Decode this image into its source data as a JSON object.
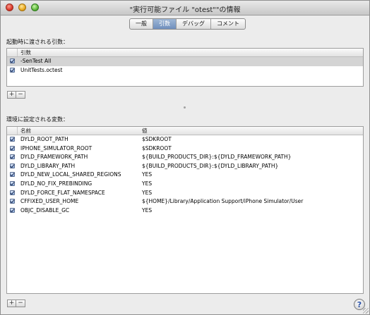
{
  "window": {
    "title": "\"実行可能ファイル \"otest\"\"の情報"
  },
  "tabs": [
    {
      "label": "一般"
    },
    {
      "label": "引数"
    },
    {
      "label": "デバッグ"
    },
    {
      "label": "コメント"
    }
  ],
  "arguments": {
    "section_label": "起動時に渡される引数：",
    "column_header": "引数",
    "rows": [
      {
        "value": "-SenTest All",
        "checked": true
      },
      {
        "value": "UnitTests.octest",
        "checked": true
      }
    ],
    "add_label": "+",
    "remove_label": "−"
  },
  "environment": {
    "section_label": "環境に設定される変数：",
    "column_name": "名前",
    "column_value": "値",
    "rows": [
      {
        "name": "DYLD_ROOT_PATH",
        "value": "$SDKROOT",
        "checked": true
      },
      {
        "name": "IPHONE_SIMULATOR_ROOT",
        "value": "$SDKROOT",
        "checked": true
      },
      {
        "name": "DYLD_FRAMEWORK_PATH",
        "value": "${BUILD_PRODUCTS_DIR}:${DYLD_FRAMEWORK_PATH}",
        "checked": true
      },
      {
        "name": "DYLD_LIBRARY_PATH",
        "value": "${BUILD_PRODUCTS_DIR}:${DYLD_LIBRARY_PATH}",
        "checked": true
      },
      {
        "name": "DYLD_NEW_LOCAL_SHARED_REGIONS",
        "value": "YES",
        "checked": true
      },
      {
        "name": "DYLD_NO_FIX_PREBINDING",
        "value": "YES",
        "checked": true
      },
      {
        "name": "DYLD_FORCE_FLAT_NAMESPACE",
        "value": "YES",
        "checked": true
      },
      {
        "name": "CFFIXED_USER_HOME",
        "value": "${HOME}/Library/Application Support/iPhone Simulator/User",
        "checked": true
      },
      {
        "name": "OBJC_DISABLE_GC",
        "value": "YES",
        "checked": true
      }
    ],
    "add_label": "+",
    "remove_label": "−"
  },
  "help": {
    "label": "?"
  }
}
